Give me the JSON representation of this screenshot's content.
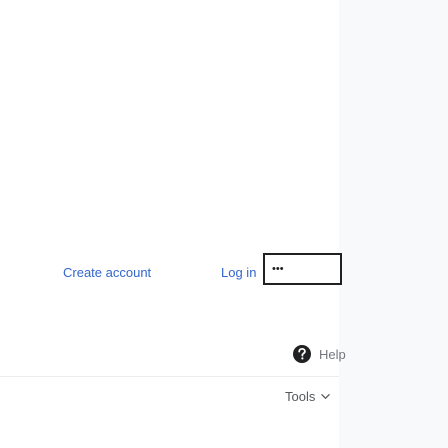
{
  "user_menu": {
    "create_account_label": "Create account",
    "login_label": "Log in",
    "more_label": "•••"
  },
  "help": {
    "icon": "help-circle-icon",
    "label": "Help"
  },
  "tools": {
    "label": "Tools",
    "icon": "chevron-down-icon"
  },
  "colors": {
    "link": "#3366cc",
    "muted_text": "#72777d",
    "tools_text": "#54595d",
    "border_dark": "#202122",
    "panel_bg": "#f8f9fa"
  }
}
